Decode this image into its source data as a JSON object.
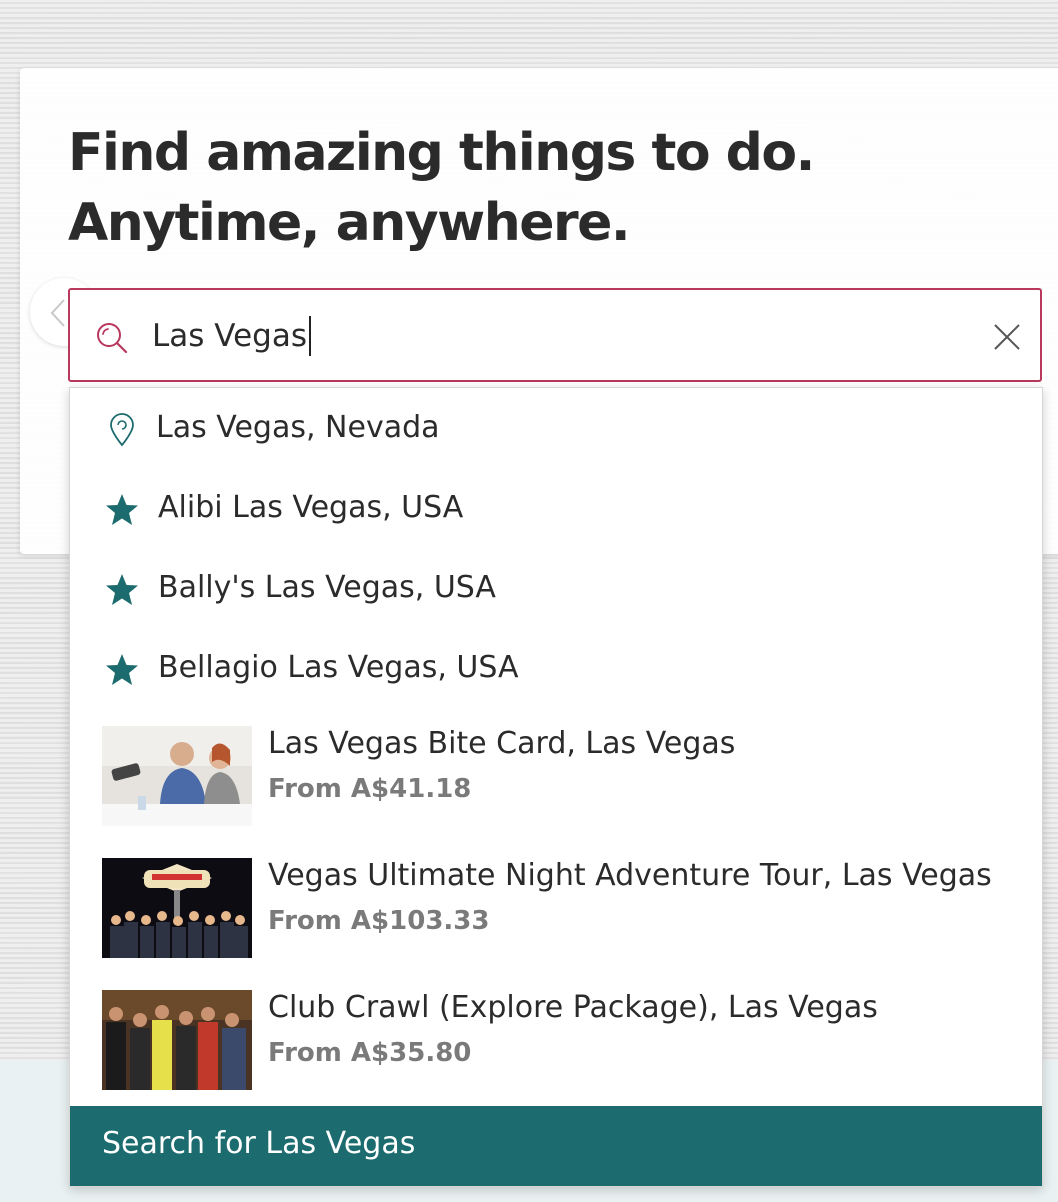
{
  "hero": {
    "headline_line1": "Find amazing things to do.",
    "headline_line2": "Anytime, anywhere."
  },
  "search": {
    "value": "Las Vegas",
    "accent_color": "#b8385e",
    "icon": "search-icon",
    "clear_icon": "close-icon"
  },
  "suggestions": [
    {
      "label": "Las Vegas, Nevada",
      "icon": "location-pin-icon"
    },
    {
      "label": "Alibi Las Vegas, USA",
      "icon": "star-icon"
    },
    {
      "label": "Bally's Las Vegas, USA",
      "icon": "star-icon"
    },
    {
      "label": "Bellagio Las Vegas, USA",
      "icon": "star-icon"
    }
  ],
  "products": [
    {
      "title": "Las Vegas Bite Card, Las Vegas",
      "price": "From A$41.18",
      "thumbnail": "dining-photo"
    },
    {
      "title": "Vegas Ultimate Night Adventure Tour, Las Vegas",
      "price": "From A$103.33",
      "thumbnail": "las-vegas-sign-group-photo"
    },
    {
      "title": "Club Crawl (Explore Package), Las Vegas",
      "price": "From A$35.80",
      "thumbnail": "club-group-photo"
    }
  ],
  "search_for": {
    "label": "Search for Las Vegas",
    "color": "#1c6b6e"
  },
  "colors": {
    "teal_icon": "#1c6b6e",
    "price_text": "#7a7a7a"
  }
}
